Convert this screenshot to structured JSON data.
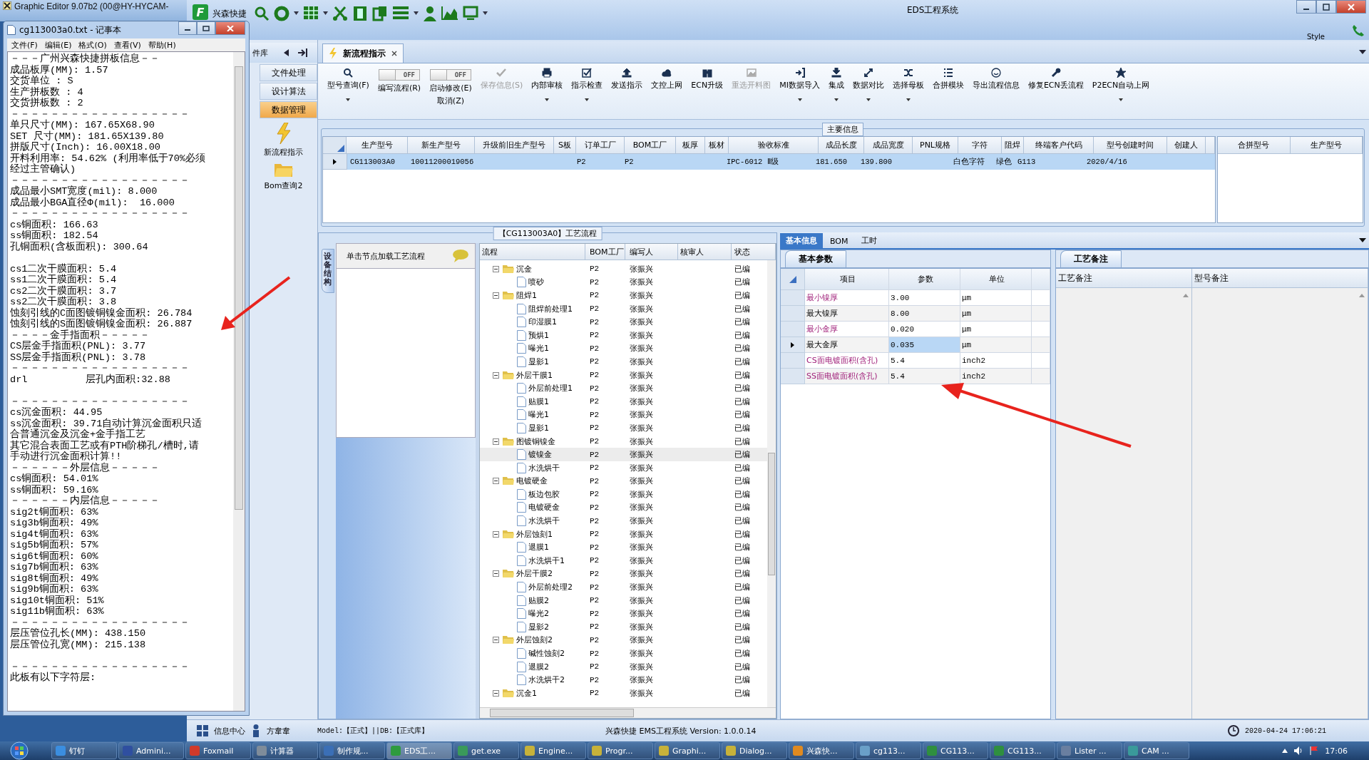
{
  "background_window": {
    "title": "Graphic Editor 9.07b2 (00@HY-HYCAM-"
  },
  "app": {
    "title": "EDS工程系统",
    "logo_letter": "F",
    "quick_label": "兴森快捷",
    "style_label": "Style"
  },
  "nav": {
    "header": "件库",
    "items": [
      {
        "label": "文件处理",
        "selected": false
      },
      {
        "label": "设计算法",
        "selected": false
      },
      {
        "label": "数据管理",
        "selected": true
      }
    ],
    "shortcuts": [
      {
        "label": "新流程指示",
        "kind": "lightning"
      },
      {
        "label": "Bom查询2",
        "kind": "folder"
      }
    ]
  },
  "tabs": [
    {
      "label": "新流程指示",
      "selected": true
    }
  ],
  "toolbar": [
    {
      "kind": "button",
      "label": "型号查询(F)",
      "disabled": false,
      "dropdown": true
    },
    {
      "kind": "toggle",
      "label": "编写流程(R)",
      "switch_text": "OFF",
      "on": false
    },
    {
      "kind": "toggle",
      "label": "启动修改(E)",
      "second_line": "取消(Z)",
      "switch_text": "OFF",
      "on": false
    },
    {
      "kind": "button",
      "label": "保存信息(S)",
      "disabled": true,
      "dropdown": false
    },
    {
      "kind": "button",
      "label": "内部审核",
      "disabled": false,
      "dropdown": true
    },
    {
      "kind": "button",
      "label": "指示检查",
      "disabled": false,
      "dropdown": true
    },
    {
      "kind": "button",
      "label": "发送指示",
      "disabled": false,
      "dropdown": false
    },
    {
      "kind": "button",
      "label": "文控上网",
      "disabled": false,
      "dropdown": false
    },
    {
      "kind": "button",
      "label": "ECN升级",
      "disabled": false,
      "dropdown": false
    },
    {
      "kind": "button",
      "label": "重选开料图",
      "disabled": true,
      "dropdown": false
    },
    {
      "kind": "button",
      "label": "MI数据导入",
      "disabled": false,
      "dropdown": true
    },
    {
      "kind": "button",
      "label": "集成",
      "disabled": false,
      "dropdown": true
    },
    {
      "kind": "button",
      "label": "数据对比",
      "disabled": false,
      "dropdown": true
    },
    {
      "kind": "button",
      "label": "选择母板",
      "disabled": false,
      "dropdown": true
    },
    {
      "kind": "button",
      "label": "合拼模块",
      "disabled": false,
      "dropdown": false
    },
    {
      "kind": "button",
      "label": "导出流程信息",
      "disabled": false,
      "dropdown": false
    },
    {
      "kind": "button",
      "label": "修复ECN丢流程",
      "disabled": false,
      "dropdown": false
    },
    {
      "kind": "button",
      "label": "P2ECN自动上网",
      "disabled": false,
      "dropdown": true
    }
  ],
  "main_info": {
    "title": "主要信息",
    "columns": [
      "生产型号",
      "新生产型号",
      "升级前旧生产型号",
      "S板",
      "订单工厂",
      "BOM工厂",
      "板厚",
      "板材",
      "验收标准",
      "成品长度",
      "成品宽度",
      "PNL规格",
      "字符",
      "阻焊",
      "终端客户代码",
      "型号创建时间",
      "创建人"
    ],
    "rows": [
      {
        "selected": true,
        "cells": [
          "CG113003A0",
          "10011200019056",
          "",
          "",
          "P2",
          "P2",
          "",
          "",
          "IPC-6012 Ⅱ级",
          "181.650",
          "139.800",
          "",
          "白色字符",
          "绿色",
          "G113",
          "2020/4/16",
          ""
        ]
      }
    ],
    "side_columns": [
      "合拼型号",
      "生产型号"
    ]
  },
  "process": {
    "title": "【CG113003A0】工艺流程",
    "side_tab": "设备结构",
    "hint": "单击节点加载工艺流程",
    "columns": [
      "流程",
      "BOM工厂",
      "编写人",
      "核审人",
      "状态"
    ],
    "tree": [
      {
        "name": "沉金",
        "bom": "P2",
        "author": "张振兴",
        "status": "已编",
        "selected": false,
        "expanded": true,
        "children": [
          {
            "name": "喷砂",
            "bom": "P2",
            "author": "张振兴",
            "status": "已编",
            "selected": false
          }
        ]
      },
      {
        "name": "阻焊1",
        "bom": "P2",
        "author": "张振兴",
        "status": "已编",
        "selected": false,
        "expanded": true,
        "children": [
          {
            "name": "阻焊前处理1",
            "bom": "P2",
            "author": "张振兴",
            "status": "已编",
            "selected": false
          },
          {
            "name": "印湿膜1",
            "bom": "P2",
            "author": "张振兴",
            "status": "已编",
            "selected": false
          },
          {
            "name": "预烘1",
            "bom": "P2",
            "author": "张振兴",
            "status": "已编",
            "selected": false
          },
          {
            "name": "曝光1",
            "bom": "P2",
            "author": "张振兴",
            "status": "已编",
            "selected": false
          },
          {
            "name": "显影1",
            "bom": "P2",
            "author": "张振兴",
            "status": "已编",
            "selected": false
          }
        ]
      },
      {
        "name": "外层干膜1",
        "bom": "P2",
        "author": "张振兴",
        "status": "已编",
        "selected": false,
        "expanded": true,
        "children": [
          {
            "name": "外层前处理1",
            "bom": "P2",
            "author": "张振兴",
            "status": "已编",
            "selected": false
          },
          {
            "name": "贴膜1",
            "bom": "P2",
            "author": "张振兴",
            "status": "已编",
            "selected": false
          },
          {
            "name": "曝光1",
            "bom": "P2",
            "author": "张振兴",
            "status": "已编",
            "selected": false
          },
          {
            "name": "显影1",
            "bom": "P2",
            "author": "张振兴",
            "status": "已编",
            "selected": false
          }
        ]
      },
      {
        "name": "图镀铜镍金",
        "bom": "P2",
        "author": "张振兴",
        "status": "已编",
        "selected": false,
        "expanded": true,
        "children": [
          {
            "name": "镀镍金",
            "bom": "P2",
            "author": "张振兴",
            "status": "已编",
            "selected": true
          },
          {
            "name": "水洗烘干",
            "bom": "P2",
            "author": "张振兴",
            "status": "已编",
            "selected": false
          }
        ]
      },
      {
        "name": "电镀硬金",
        "bom": "P2",
        "author": "张振兴",
        "status": "已编",
        "selected": false,
        "expanded": true,
        "children": [
          {
            "name": "板边包胶",
            "bom": "P2",
            "author": "张振兴",
            "status": "已编",
            "selected": false
          },
          {
            "name": "电镀硬金",
            "bom": "P2",
            "author": "张振兴",
            "status": "已编",
            "selected": false
          },
          {
            "name": "水洗烘干",
            "bom": "P2",
            "author": "张振兴",
            "status": "已编",
            "selected": false
          }
        ]
      },
      {
        "name": "外层蚀刻1",
        "bom": "P2",
        "author": "张振兴",
        "status": "已编",
        "selected": false,
        "expanded": true,
        "children": [
          {
            "name": "退膜1",
            "bom": "P2",
            "author": "张振兴",
            "status": "已编",
            "selected": false
          },
          {
            "name": "水洗烘干1",
            "bom": "P2",
            "author": "张振兴",
            "status": "已编",
            "selected": false
          }
        ]
      },
      {
        "name": "外层干膜2",
        "bom": "P2",
        "author": "张振兴",
        "status": "已编",
        "selected": false,
        "expanded": true,
        "children": [
          {
            "name": "外层前处理2",
            "bom": "P2",
            "author": "张振兴",
            "status": "已编",
            "selected": false
          },
          {
            "name": "贴膜2",
            "bom": "P2",
            "author": "张振兴",
            "status": "已编",
            "selected": false
          },
          {
            "name": "曝光2",
            "bom": "P2",
            "author": "张振兴",
            "status": "已编",
            "selected": false
          },
          {
            "name": "显影2",
            "bom": "P2",
            "author": "张振兴",
            "status": "已编",
            "selected": false
          }
        ]
      },
      {
        "name": "外层蚀刻2",
        "bom": "P2",
        "author": "张振兴",
        "status": "已编",
        "selected": false,
        "expanded": true,
        "children": [
          {
            "name": "碱性蚀刻2",
            "bom": "P2",
            "author": "张振兴",
            "status": "已编",
            "selected": false
          },
          {
            "name": "退膜2",
            "bom": "P2",
            "author": "张振兴",
            "status": "已编",
            "selected": false
          },
          {
            "name": "水洗烘干2",
            "bom": "P2",
            "author": "张振兴",
            "status": "已编",
            "selected": false
          }
        ]
      },
      {
        "name": "沉金1",
        "bom": "P2",
        "author": "张振兴",
        "status": "已编",
        "selected": false,
        "expanded": true
      }
    ]
  },
  "detail": {
    "tabs": [
      {
        "label": "基本信息",
        "selected": true
      },
      {
        "label": "BOM",
        "selected": false
      },
      {
        "label": "工时",
        "selected": false
      }
    ],
    "params_tab": "基本参数",
    "params_columns": [
      "项目",
      "参数",
      "单位"
    ],
    "params": [
      {
        "item": "最小镍厚",
        "value": "3.00",
        "unit": "μm",
        "highlighted": true,
        "selected": false
      },
      {
        "item": "最大镍厚",
        "value": "8.00",
        "unit": "μm",
        "highlighted": false,
        "selected": false
      },
      {
        "item": "最小金厚",
        "value": "0.020",
        "unit": "μm",
        "highlighted": true,
        "selected": false
      },
      {
        "item": "最大金厚",
        "value": "0.035",
        "unit": "μm",
        "highlighted": false,
        "selected": true
      },
      {
        "item": "CS面电镀面积(含孔)",
        "value": "5.4",
        "unit": "inch2",
        "highlighted": true,
        "selected": false
      },
      {
        "item": "SS面电镀面积(含孔)",
        "value": "5.4",
        "unit": "inch2",
        "highlighted": true,
        "selected": false
      }
    ],
    "notes_tab": "工艺备注",
    "notes_columns": [
      "工艺备注",
      "型号备注"
    ]
  },
  "status_bar": {
    "info_center": "信息中心",
    "user": "方韋韋",
    "model": "Model:【正式】||DB:【正式库】",
    "version": "兴森快捷 EMS工程系统 Version: 1.0.0.14",
    "datetime": "2020-04-24 17:06:21"
  },
  "notepad": {
    "title": "cg113003a0.txt - 记事本",
    "menu": [
      "文件(F)",
      "编辑(E)",
      "格式(O)",
      "查看(V)",
      "帮助(H)"
    ],
    "lines": [
      "－－－广州兴森快捷拼板信息－－",
      "成品板厚(MM): 1.57",
      "交货单位 : S",
      "生产拼板数 : 4",
      "交货拼板数 : 2",
      "－－－－－－－－－－－－－－－－－－",
      "单只尺寸(MM): 167.65X68.90",
      "SET 尺寸(MM): 181.65X139.80",
      "拼版尺寸(Inch): 16.00X18.00",
      "开料利用率: 54.62% (利用率低于70%必须",
      "经过主管确认)",
      "－－－－－－－－－－－－－－－－－－",
      "成品最小SMT宽度(mil): 8.000",
      "成品最小BGA直径Φ(mil):  16.000",
      "－－－－－－－－－－－－－－－－－－",
      "cs铜面积: 166.63",
      "ss铜面积: 182.54",
      "孔铜面积(含板面积): 300.64",
      {
        "text": "cs1二次干膜面积: 5.4",
        "space_before": true
      },
      "ss1二次干膜面积: 5.4",
      "cs2二次干膜面积: 3.7",
      "ss2二次干膜面积: 3.8",
      "蚀刻引线的C面图镀铜镍金面积: 26.784",
      "蚀刻引线的S面图镀铜镍金面积: 26.887",
      "－－－－金手指面积－－－－－",
      "CS层金手指面积(PNL): 3.77",
      "SS层金手指面积(PNL): 3.78",
      "－－－－－－－－－－－－－－－－－－",
      "drl          层孔内面积:32.88",
      {
        "text": "－－－－－－－－－－－－－－－－－－",
        "space_before": true
      },
      "cs沉金面积: 44.95",
      "ss沉金面积: 39.71自动计算沉金面积只适",
      "合普通沉金及沉金+金手指工艺",
      "其它混合表面工艺或有PTH阶梯孔/槽时,请",
      "手动进行沉金面积计算!!",
      "－－－－－－外层信息－－－－－",
      "cs铜面积: 54.01%",
      "ss铜面积: 59.16%",
      "－－－－－－内层信息－－－－－",
      "sig2t铜面积: 63%",
      "sig3b铜面积: 49%",
      "sig4t铜面积: 63%",
      "sig5b铜面积: 57%",
      "sig6t铜面积: 60%",
      "sig7b铜面积: 63%",
      "sig8t铜面积: 49%",
      "sig9b铜面积: 63%",
      "sig10t铜面积: 51%",
      "sig11b铜面积: 63%",
      "－－－－－－－－－－－－－－－－－－",
      "层压管位孔长(MM): 438.150",
      "层压管位孔宽(MM): 215.138",
      {
        "text": "－－－－－－－－－－－－－－－－－－",
        "space_before": true
      },
      "此板有以下字符层:"
    ]
  },
  "taskbar": {
    "items": [
      {
        "label": "钉钉",
        "selected": false
      },
      {
        "label": "Admini...",
        "selected": false
      },
      {
        "label": "Foxmail",
        "selected": false
      },
      {
        "label": "计算器",
        "selected": false
      },
      {
        "label": "制作规...",
        "selected": false
      },
      {
        "label": "EDS工...",
        "selected": true
      },
      {
        "label": "get.exe",
        "selected": false
      },
      {
        "label": "Engine...",
        "selected": false
      },
      {
        "label": "Progr...",
        "selected": false
      },
      {
        "label": "Graphi...",
        "selected": false
      },
      {
        "label": "Dialog...",
        "selected": false
      },
      {
        "label": "兴森快...",
        "selected": false
      },
      {
        "label": "cg113...",
        "selected": false
      },
      {
        "label": "CG113...",
        "selected": false
      },
      {
        "label": "CG113...",
        "selected": false
      },
      {
        "label": "Lister ...",
        "selected": false
      },
      {
        "label": "CAM ...",
        "selected": false
      }
    ],
    "clock": "17:06"
  }
}
